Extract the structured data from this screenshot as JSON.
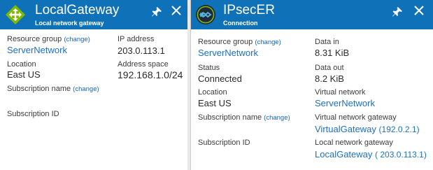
{
  "colors": {
    "header_bg": "#0f72b8",
    "link": "#1d6fc0",
    "change_link": "#1565c0"
  },
  "blade1": {
    "icon": "local-gateway-icon",
    "title": "LocalGateway",
    "subtitle": "Local network gateway",
    "left": {
      "resource_group_label": "Resource group",
      "resource_group_change": "(change)",
      "resource_group_value": "ServerNetwork",
      "location_label": "Location",
      "location_value": "East US",
      "subscription_name_label": "Subscription name",
      "subscription_name_change": "(change)",
      "subscription_id_label": "Subscription ID"
    },
    "right": {
      "ip_address_label": "IP address",
      "ip_address_value": "203.0.113.1",
      "address_space_label": "Address space",
      "address_space_value": "192.168.1.0/24"
    }
  },
  "blade2": {
    "icon": "connection-icon",
    "title": "IPsecER",
    "subtitle": "Connection",
    "left": {
      "resource_group_label": "Resource group",
      "resource_group_change": "(change)",
      "resource_group_value": "ServerNetwork",
      "status_label": "Status",
      "status_value": "Connected",
      "location_label": "Location",
      "location_value": "East US",
      "subscription_name_label": "Subscription name",
      "subscription_name_change": "(change)",
      "subscription_id_label": "Subscription ID"
    },
    "right": {
      "data_in_label": "Data in",
      "data_in_value": "8.31 KiB",
      "data_out_label": "Data out",
      "data_out_value": "8.2 KiB",
      "virtual_network_label": "Virtual network",
      "virtual_network_value": "ServerNetwork",
      "vnet_gateway_label": "Virtual network gateway",
      "vnet_gateway_name": "VirtualGateway",
      "vnet_gateway_ip": "(192.0.2.1)",
      "local_gateway_label": "Local network gateway",
      "local_gateway_name": "LocalGateway",
      "local_gateway_ip": "( 203.0.113.1)"
    }
  }
}
